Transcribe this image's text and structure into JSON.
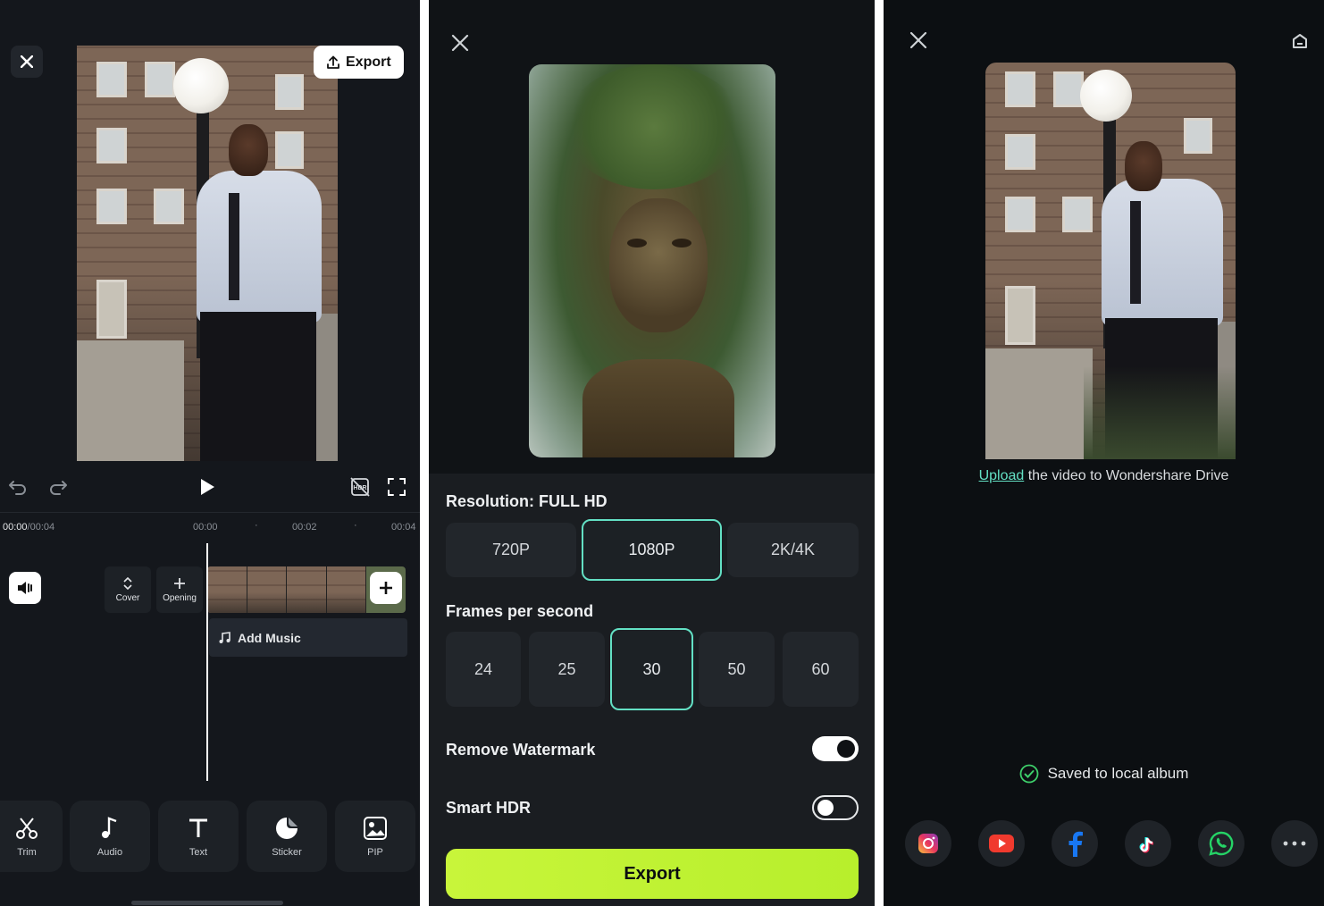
{
  "editor": {
    "export_label": "Export",
    "time_current": "00:00",
    "time_total": "/00:04",
    "ruler_labels": [
      "00:00",
      "00:02",
      "00:04"
    ],
    "cover_label": "Cover",
    "opening_label": "Opening",
    "add_music_label": "Add Music",
    "toolbar": [
      {
        "label": "Trim",
        "icon": "scissors-icon"
      },
      {
        "label": "Audio",
        "icon": "music-note-icon"
      },
      {
        "label": "Text",
        "icon": "text-icon"
      },
      {
        "label": "Sticker",
        "icon": "sticker-icon"
      },
      {
        "label": "PIP",
        "icon": "pip-icon"
      }
    ]
  },
  "export_settings": {
    "resolution_title": "Resolution: FULL HD",
    "resolutions": [
      "720P",
      "1080P",
      "2K/4K"
    ],
    "selected_resolution": "1080P",
    "fps_title": "Frames per second",
    "fps_options": [
      "24",
      "25",
      "30",
      "50",
      "60"
    ],
    "selected_fps": "30",
    "remove_watermark_label": "Remove Watermark",
    "remove_watermark_on": true,
    "smart_hdr_label": "Smart HDR",
    "smart_hdr_on": false,
    "export_button": "Export"
  },
  "share_screen": {
    "upload_link": "Upload",
    "upload_rest": " the video to Wondershare Drive",
    "saved_text": "Saved to local album",
    "share_targets": [
      "instagram-icon",
      "youtube-icon",
      "facebook-icon",
      "tiktok-icon",
      "whatsapp-icon",
      "more-icon"
    ]
  },
  "colors": {
    "accent_teal": "#63e0c4",
    "export_green": "#c8f53a",
    "upload_link": "#63e0c4"
  }
}
